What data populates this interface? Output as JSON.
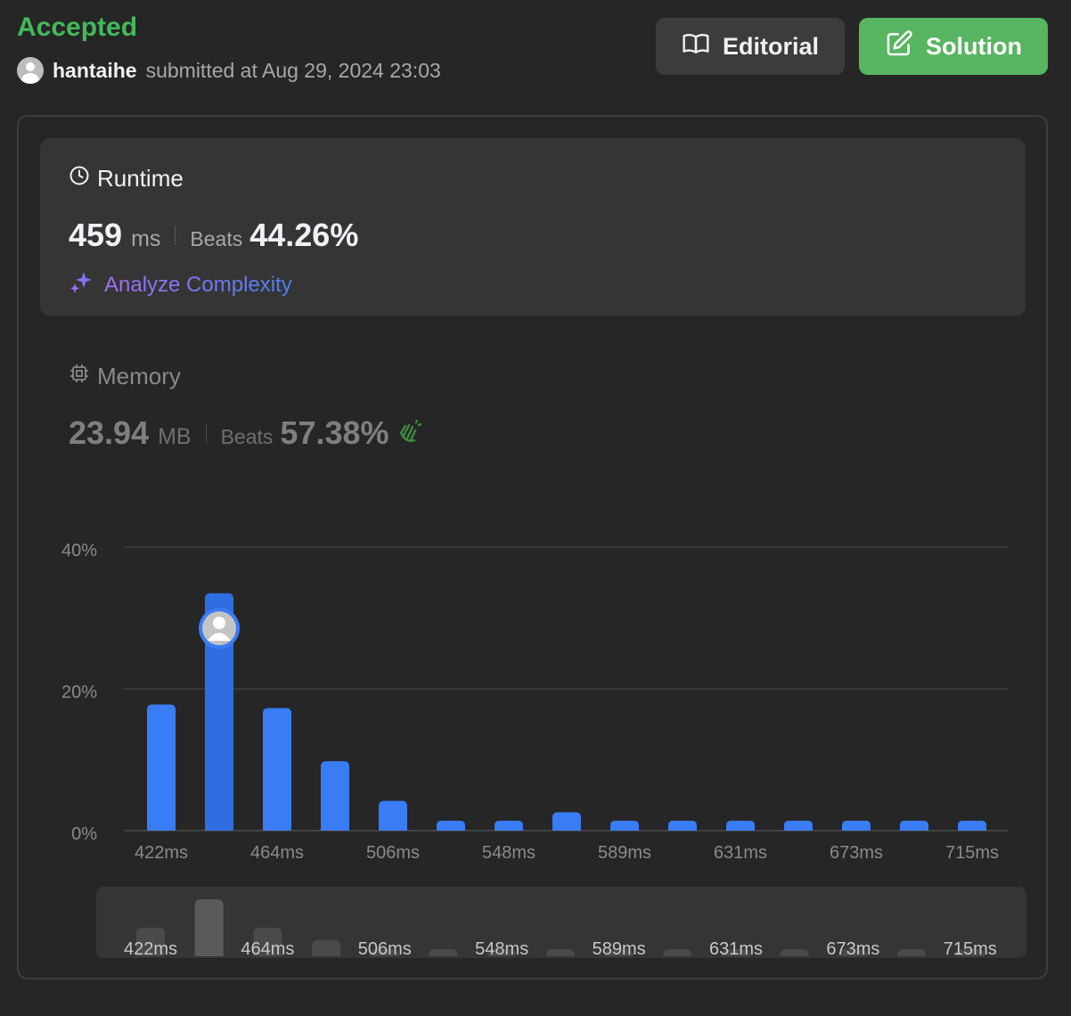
{
  "header": {
    "status": "Accepted",
    "username": "hantaihe",
    "submitted_text": "submitted at Aug 29, 2024 23:03"
  },
  "buttons": {
    "editorial_label": "Editorial",
    "solution_label": "Solution"
  },
  "runtime": {
    "title": "Runtime",
    "value": "459",
    "unit": "ms",
    "beats_label": "Beats",
    "beats_value": "44.26%",
    "analyze_label": "Analyze Complexity"
  },
  "memory": {
    "title": "Memory",
    "value": "23.94",
    "unit": "MB",
    "beats_label": "Beats",
    "beats_value": "57.38%"
  },
  "colors": {
    "accepted": "#43b95a",
    "bar": "#3a7cf4",
    "bar_selected": "#2f6ee0",
    "mini_bar": "#4a4a4a",
    "mini_bar_selected": "#5a5a5a",
    "solution_button": "#58b561"
  },
  "icons": {
    "editorial": "book-open-icon",
    "solution": "edit-icon",
    "runtime": "clock-icon",
    "memory": "chip-icon",
    "analyze": "sparkle-icon",
    "memory_beats": "clap-icon"
  },
  "chart_data": {
    "type": "bar",
    "title": "",
    "xlabel": "",
    "ylabel": "",
    "ylim": [
      0,
      40
    ],
    "y_ticks": [
      "0%",
      "20%",
      "40%"
    ],
    "x_tick_labels": [
      "422ms",
      "464ms",
      "506ms",
      "548ms",
      "589ms",
      "631ms",
      "673ms",
      "715ms"
    ],
    "values": [
      17.8,
      33.5,
      17.3,
      9.8,
      4.2,
      1.4,
      1.4,
      2.6,
      1.4,
      1.4,
      1.4,
      1.4,
      1.4,
      1.4,
      1.4
    ],
    "selected_index": 1,
    "grid": true,
    "overview_values": [
      4,
      8,
      4,
      2.3,
      1,
      1,
      1,
      1,
      1,
      1,
      1,
      1,
      1,
      1,
      1
    ],
    "overview_tick_labels": [
      "422ms",
      "464ms",
      "506ms",
      "548ms",
      "589ms",
      "631ms",
      "673ms",
      "715ms"
    ]
  }
}
